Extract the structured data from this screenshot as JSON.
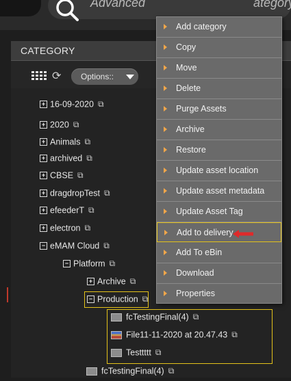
{
  "topbar": {
    "search_placeholder_start": "Advanced",
    "search_placeholder_end": "ategory/"
  },
  "panel": {
    "title": "CATEGORY",
    "options_label": "Options::"
  },
  "tree": [
    {
      "label": "16-09-2020",
      "toggle": "+"
    },
    {
      "label": "2020",
      "toggle": "+"
    },
    {
      "label": "Animals",
      "toggle": "+"
    },
    {
      "label": "archived",
      "toggle": "+"
    },
    {
      "label": "CBSE",
      "toggle": "+"
    },
    {
      "label": "dragdropTest",
      "toggle": "+"
    },
    {
      "label": "efeederT",
      "toggle": "+"
    },
    {
      "label": "electron",
      "toggle": "+"
    },
    {
      "label": "eMAM Cloud",
      "toggle": "−"
    },
    {
      "label": "Platform",
      "toggle": "−"
    },
    {
      "label": "Archive",
      "toggle": "+"
    },
    {
      "label": "Production",
      "toggle": "−"
    }
  ],
  "assets": [
    {
      "label": "fcTestingFinal(4)",
      "kind": "video"
    },
    {
      "label": "File11-11-2020 at 20.47.43",
      "kind": "image"
    },
    {
      "label": "Testtttt",
      "kind": "video"
    },
    {
      "label": "fcTestingFinal(4)",
      "kind": "video"
    }
  ],
  "context_menu": {
    "items": [
      "Add category",
      "Copy",
      "Move",
      "Delete",
      "Purge Assets",
      "Archive",
      "Restore",
      "Update asset location",
      "Update asset metadata",
      "Update Asset Tag",
      "Add to delivery",
      "Add To eBin",
      "Download",
      "Properties"
    ],
    "highlighted": "Add to delivery"
  },
  "colors": {
    "highlight": "#e4c21a",
    "menu_arrow": "#f0a64a",
    "pointer_arrow": "#e02a2a"
  }
}
